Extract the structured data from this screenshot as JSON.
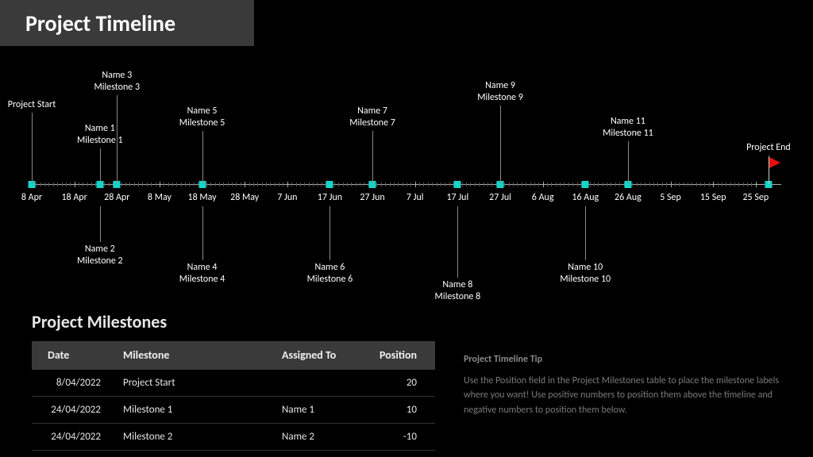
{
  "page": {
    "title": "Project Timeline",
    "section_title": "Project Milestones"
  },
  "tip": {
    "title": "Project Timeline Tip",
    "body": "Use the Position field in the Project Milestones table to place the milestone labels where you want! Use positive numbers to position them above the timeline and negative numbers to position them below."
  },
  "chart_data": {
    "type": "timeline",
    "axis_range": [
      "2022-04-08",
      "2022-10-01"
    ],
    "axis_ticks": [
      "8 Apr",
      "18 Apr",
      "28 Apr",
      "8 May",
      "18 May",
      "28 May",
      "7 Jun",
      "17 Jun",
      "27 Jun",
      "7 Jul",
      "17 Jul",
      "27 Jul",
      "6 Aug",
      "16 Aug",
      "26 Aug",
      "5 Sep",
      "15 Sep",
      "25 Sep"
    ],
    "milestones": [
      {
        "date": "2022-04-08",
        "label_lines": [
          "Project Start"
        ],
        "position": 20,
        "assigned_to": ""
      },
      {
        "date": "2022-04-24",
        "label_lines": [
          "Name 1",
          "Milestone 1"
        ],
        "position": 10,
        "assigned_to": "Name 1"
      },
      {
        "date": "2022-04-24",
        "label_lines": [
          "Name 2",
          "Milestone 2"
        ],
        "position": -10,
        "assigned_to": "Name 2"
      },
      {
        "date": "2022-04-28",
        "label_lines": [
          "Name 3",
          "Milestone 3"
        ],
        "position": 25,
        "assigned_to": "Name 3"
      },
      {
        "date": "2022-05-18",
        "label_lines": [
          "Name 4",
          "Milestone 4"
        ],
        "position": -15,
        "assigned_to": "Name 4"
      },
      {
        "date": "2022-05-18",
        "label_lines": [
          "Name 5",
          "Milestone 5"
        ],
        "position": 15,
        "assigned_to": "Name 5"
      },
      {
        "date": "2022-06-17",
        "label_lines": [
          "Name 6",
          "Milestone 6"
        ],
        "position": -15,
        "assigned_to": "Name 6"
      },
      {
        "date": "2022-06-27",
        "label_lines": [
          "Name 7",
          "Milestone 7"
        ],
        "position": 15,
        "assigned_to": "Name 7"
      },
      {
        "date": "2022-07-17",
        "label_lines": [
          "Name 8",
          "Milestone 8"
        ],
        "position": -20,
        "assigned_to": "Name 8"
      },
      {
        "date": "2022-07-27",
        "label_lines": [
          "Name 9",
          "Milestone 9"
        ],
        "position": 22,
        "assigned_to": "Name 9"
      },
      {
        "date": "2022-08-16",
        "label_lines": [
          "Name 10",
          "Milestone 10"
        ],
        "position": -15,
        "assigned_to": "Name 10"
      },
      {
        "date": "2022-08-26",
        "label_lines": [
          "Name 11",
          "Milestone 11"
        ],
        "position": 12,
        "assigned_to": "Name 11"
      },
      {
        "date": "2022-09-28",
        "label_lines": [
          "Project End"
        ],
        "position": 8,
        "assigned_to": "",
        "end_flag": true
      }
    ]
  },
  "table": {
    "headers": {
      "date": "Date",
      "milestone": "Milestone",
      "assigned": "Assigned To",
      "position": "Position"
    },
    "rows": [
      {
        "date": "8/04/2022",
        "milestone": "Project Start",
        "assigned": "",
        "position": "20"
      },
      {
        "date": "24/04/2022",
        "milestone": "Milestone 1",
        "assigned": "Name 1",
        "position": "10"
      },
      {
        "date": "24/04/2022",
        "milestone": "Milestone 2",
        "assigned": "Name 2",
        "position": "-10"
      }
    ]
  },
  "colors": {
    "accent": "#16d4c8",
    "flag": "#e31111"
  }
}
